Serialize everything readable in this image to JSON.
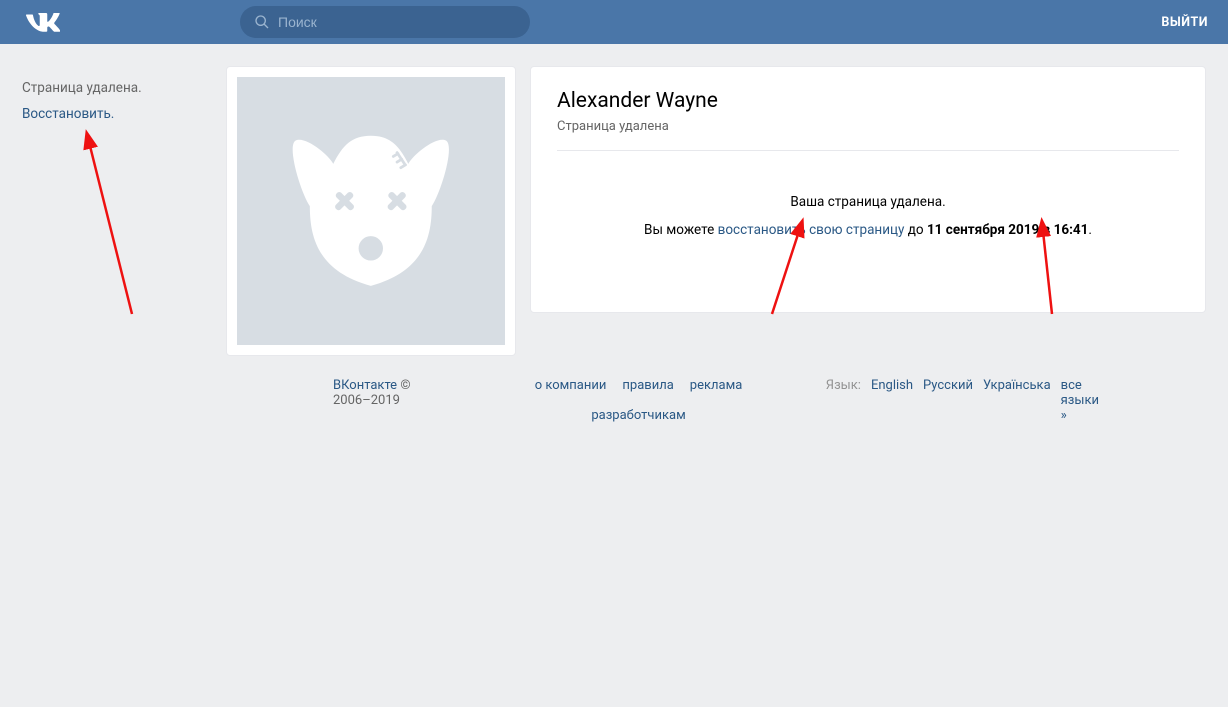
{
  "header": {
    "search_placeholder": "Поиск",
    "logout": "ВЫЙТИ"
  },
  "sidebar": {
    "status": "Страница удалена.",
    "restore": "Восстановить."
  },
  "profile": {
    "name": "Alexander Wayne",
    "subtitle": "Страница удалена",
    "deleted_title": "Ваша страница удалена.",
    "line2_prefix": "Вы можете ",
    "line2_link": "восстановить свою страницу",
    "line2_mid": " до ",
    "line2_date": "11 сентября 2019 в 16:41",
    "line2_suffix": "."
  },
  "footer": {
    "brand": "ВКонтакте",
    "copyright": " © 2006–2019",
    "links": {
      "about": "о компании",
      "rules": "правила",
      "ads": "реклама",
      "devs": "разработчикам"
    },
    "lang_label": "Язык:",
    "langs": {
      "en": "English",
      "ru": "Русский",
      "uk": "Українська",
      "all": "все языки »"
    }
  }
}
